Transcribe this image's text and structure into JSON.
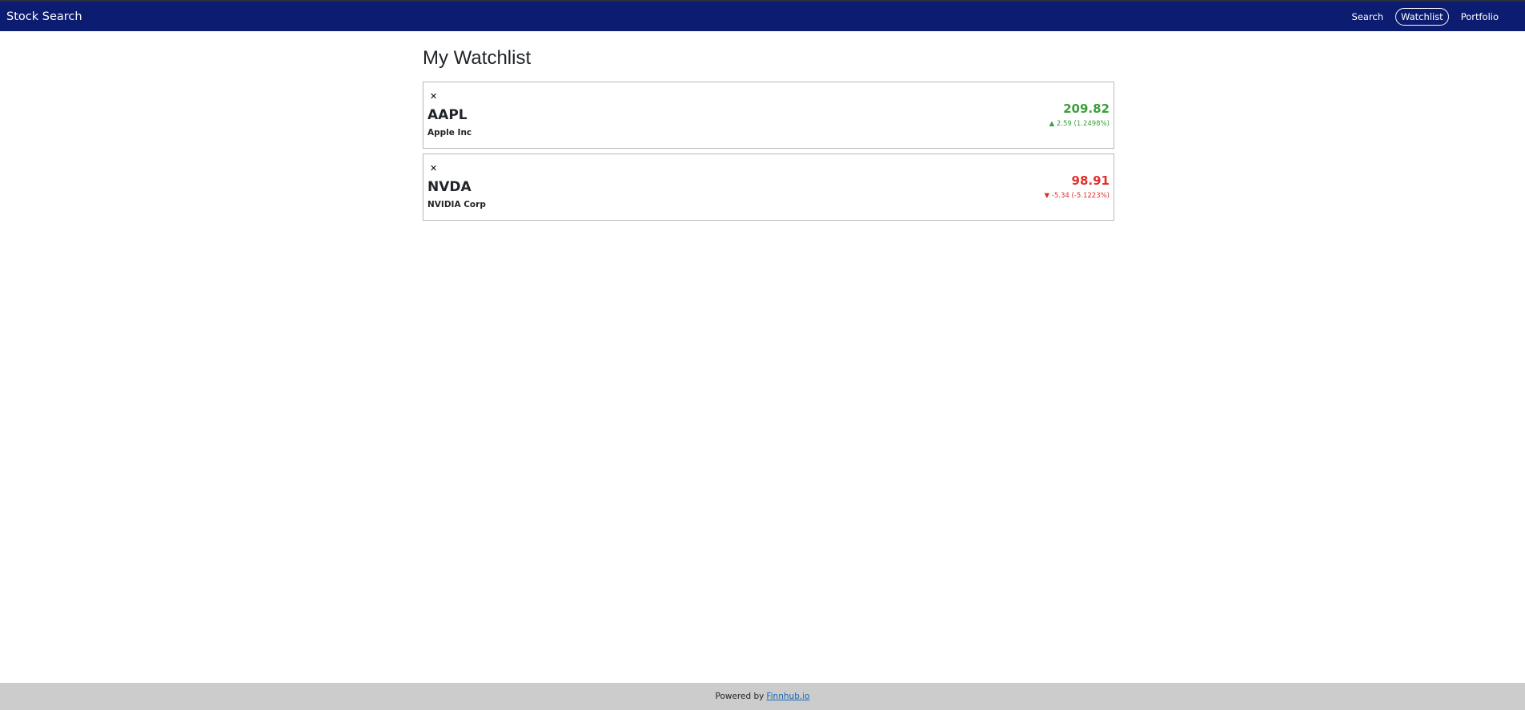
{
  "navbar": {
    "brand": "Stock Search",
    "links": [
      {
        "label": "Search"
      },
      {
        "label": "Watchlist",
        "active": true
      },
      {
        "label": "Portfolio"
      }
    ],
    "background_color": "#0c1c70"
  },
  "main": {
    "title": "My Watchlist",
    "remove_icon": "close-icon",
    "items": [
      {
        "ticker": "AAPL",
        "name": "Apple Inc",
        "price": "209.82",
        "direction_icon": "▲",
        "change": "2.59 (1.2498%)",
        "trend": "up"
      },
      {
        "ticker": "NVDA",
        "name": "NVIDIA Corp",
        "price": "98.91",
        "direction_icon": "▼",
        "change": "-5.34 (-5.1223%)",
        "trend": "down"
      }
    ]
  },
  "footer": {
    "text": "Powered by",
    "link_text": "Finnhub.io"
  },
  "colors": {
    "up": "#3a9f3a",
    "down": "#e0302c",
    "link": "#1565c0",
    "footer_bg": "#cccccc"
  }
}
